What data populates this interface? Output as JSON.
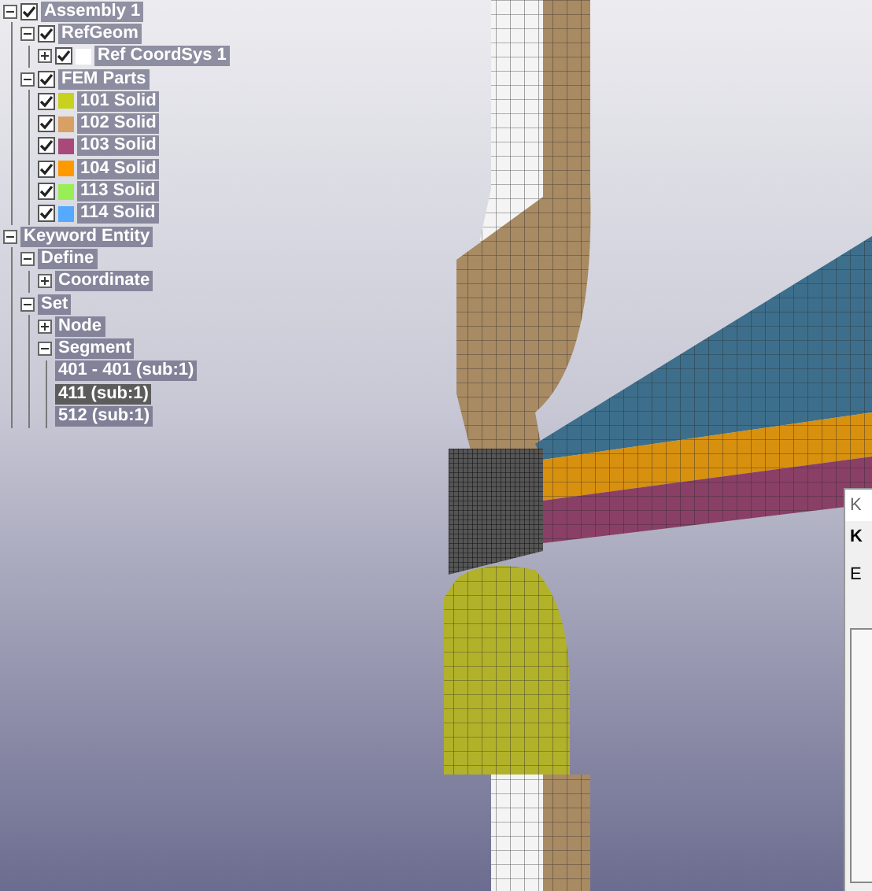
{
  "tree": [
    {
      "label": "Assembly 1",
      "expanded": true,
      "checked": true,
      "selected": false,
      "children": [
        {
          "label": "RefGeom",
          "expanded": true,
          "checked": true,
          "selected": false,
          "children": [
            {
              "label": "Ref CoordSys 1",
              "expanded": false,
              "checked": true,
              "color": "#ffffff",
              "selected": false
            }
          ]
        },
        {
          "label": "FEM Parts",
          "expanded": true,
          "checked": true,
          "selected": false,
          "children": [
            {
              "label": "101 Solid",
              "checked": true,
              "color": "#c8d21e",
              "selected": false
            },
            {
              "label": "102 Solid",
              "checked": true,
              "color": "#d9a066",
              "selected": false
            },
            {
              "label": "103 Solid",
              "checked": true,
              "color": "#a8497a",
              "selected": false
            },
            {
              "label": "104 Solid",
              "checked": true,
              "color": "#ff9900",
              "selected": false
            },
            {
              "label": "113 Solid",
              "checked": true,
              "color": "#99ee55",
              "selected": false
            },
            {
              "label": "114 Solid",
              "checked": true,
              "color": "#55aaff",
              "selected": false
            }
          ]
        }
      ]
    },
    {
      "label": "Keyword Entity",
      "expanded": true,
      "selected": false,
      "children": [
        {
          "label": "Define",
          "expanded": true,
          "selected": false,
          "children": [
            {
              "label": "Coordinate",
              "expanded": false,
              "selected": false
            }
          ]
        },
        {
          "label": "Set",
          "expanded": true,
          "selected": false,
          "children": [
            {
              "label": "Node",
              "expanded": false,
              "selected": false
            },
            {
              "label": "Segment",
              "expanded": true,
              "selected": false,
              "children": [
                {
                  "label": "401 - 401 (sub:1)",
                  "selected": false
                },
                {
                  "label": "411 (sub:1)",
                  "selected": true
                },
                {
                  "label": "512 (sub:1)",
                  "selected": false
                }
              ]
            }
          ]
        }
      ]
    }
  ],
  "dialog": {
    "title": "K",
    "heading": "K",
    "label": "E"
  }
}
